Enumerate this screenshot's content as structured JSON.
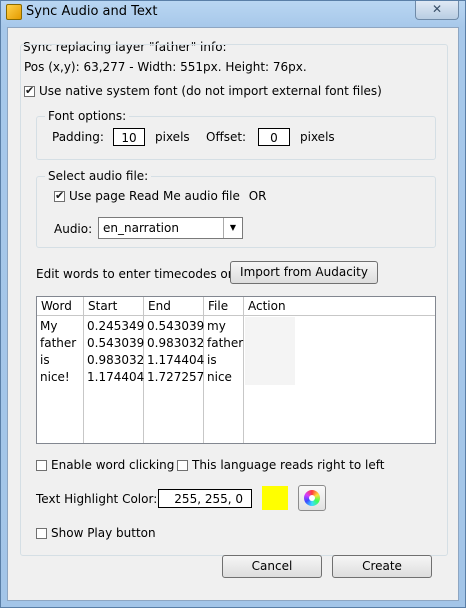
{
  "window": {
    "title": "Sync Audio and Text",
    "close_glyph": "✕"
  },
  "sync_group": {
    "legend": "Sync replacing layer \"father\" info:",
    "pos_info": "Pos (x,y): 63,277 - Width: 551px. Height: 76px.",
    "native_font_label": "Use native system font (do not import external font files)",
    "native_font_checked": true
  },
  "font_options": {
    "legend": "Font options:",
    "padding_label": "Padding:",
    "padding_value": "10",
    "padding_unit": "pixels",
    "offset_label": "Offset:",
    "offset_value": "0",
    "offset_unit": "pixels"
  },
  "audio_group": {
    "legend": "Select audio file:",
    "readme_label": "Use page Read Me audio file",
    "readme_checked": true,
    "or_text": "OR",
    "audio_label": "Audio:",
    "audio_value": "en_narration"
  },
  "timecodes": {
    "edit_label": "Edit words to enter timecodes or",
    "import_button": "Import from Audacity"
  },
  "table": {
    "headers": [
      "Word",
      "Start",
      "End",
      "File",
      "Action"
    ],
    "rows": [
      [
        "My",
        "0.245349",
        "0.543039",
        "my",
        ""
      ],
      [
        "father",
        "0.543039",
        "0.983032",
        "father",
        ""
      ],
      [
        "is",
        "0.983032",
        "1.174404",
        "is",
        ""
      ],
      [
        "nice!",
        "1.174404",
        "1.727257",
        "nice",
        ""
      ]
    ]
  },
  "options": {
    "word_clicking_label": "Enable word clicking",
    "word_clicking_checked": false,
    "rtl_label": "This language reads right to left",
    "rtl_checked": false,
    "highlight_label": "Text Highlight Color:",
    "highlight_value": "255, 255, 0",
    "highlight_color": "#ffff00",
    "show_play_label": "Show Play button",
    "show_play_checked": false
  },
  "buttons": {
    "cancel": "Cancel",
    "create": "Create"
  }
}
